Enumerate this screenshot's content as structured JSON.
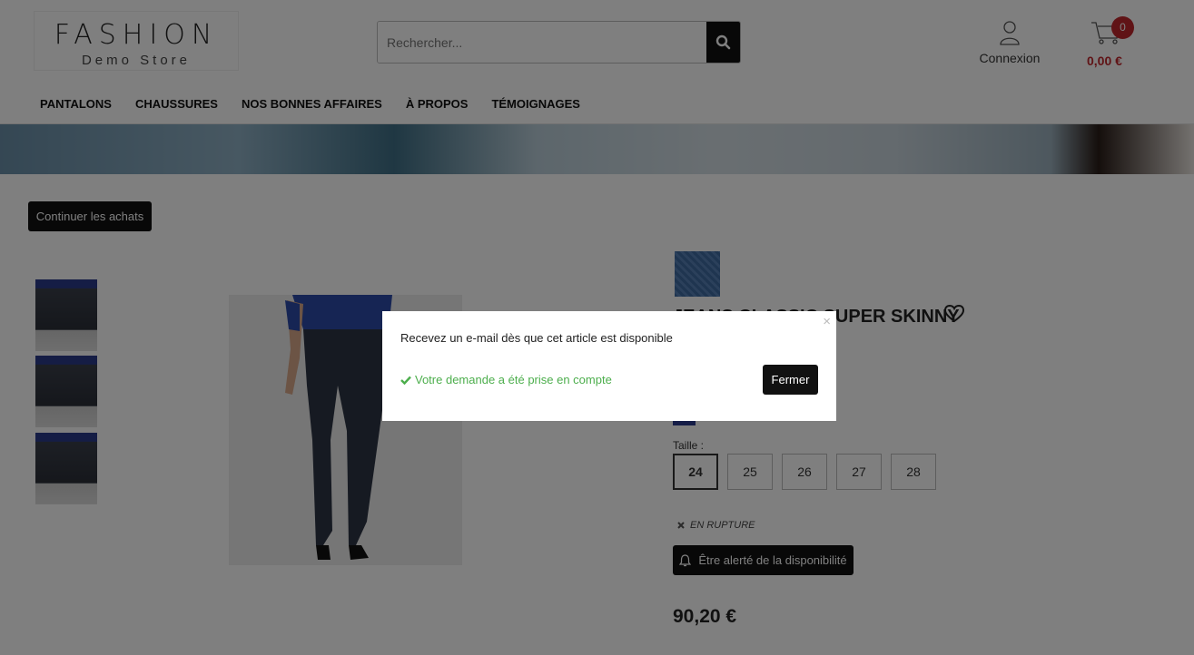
{
  "brand": {
    "line1": "FASHION",
    "line2": "Demo Store"
  },
  "search": {
    "placeholder": "Rechercher..."
  },
  "account": {
    "label": "Connexion"
  },
  "cart": {
    "count": "0",
    "total": "0,00 €"
  },
  "nav": [
    "PANTALONS",
    "CHAUSSURES",
    "NOS BONNES AFFAIRES",
    "À PROPOS",
    "TÉMOIGNAGES"
  ],
  "continue_label": "Continuer les achats",
  "product": {
    "title": "JEANS CLASSIC SUPER SKINNY",
    "size_label": "Taille :",
    "sizes": [
      "24",
      "25",
      "26",
      "27",
      "28"
    ],
    "selected_size": "24",
    "stock_status": "EN RUPTURE",
    "alert_label": "Être alerté de la disponibilité",
    "price": "90,20 €"
  },
  "modal": {
    "close": "×",
    "message": "Recevez un e-mail dès que cet article est disponible",
    "success": "Votre demande a été prise en compte",
    "button": "Fermer"
  },
  "colors": {
    "accent": "#c0272d",
    "success": "#4cae4c",
    "dark": "#111111"
  },
  "icons": [
    "search-icon",
    "user-icon",
    "cart-icon",
    "heart-icon",
    "bell-icon",
    "check-icon",
    "x-icon",
    "close-icon"
  ]
}
